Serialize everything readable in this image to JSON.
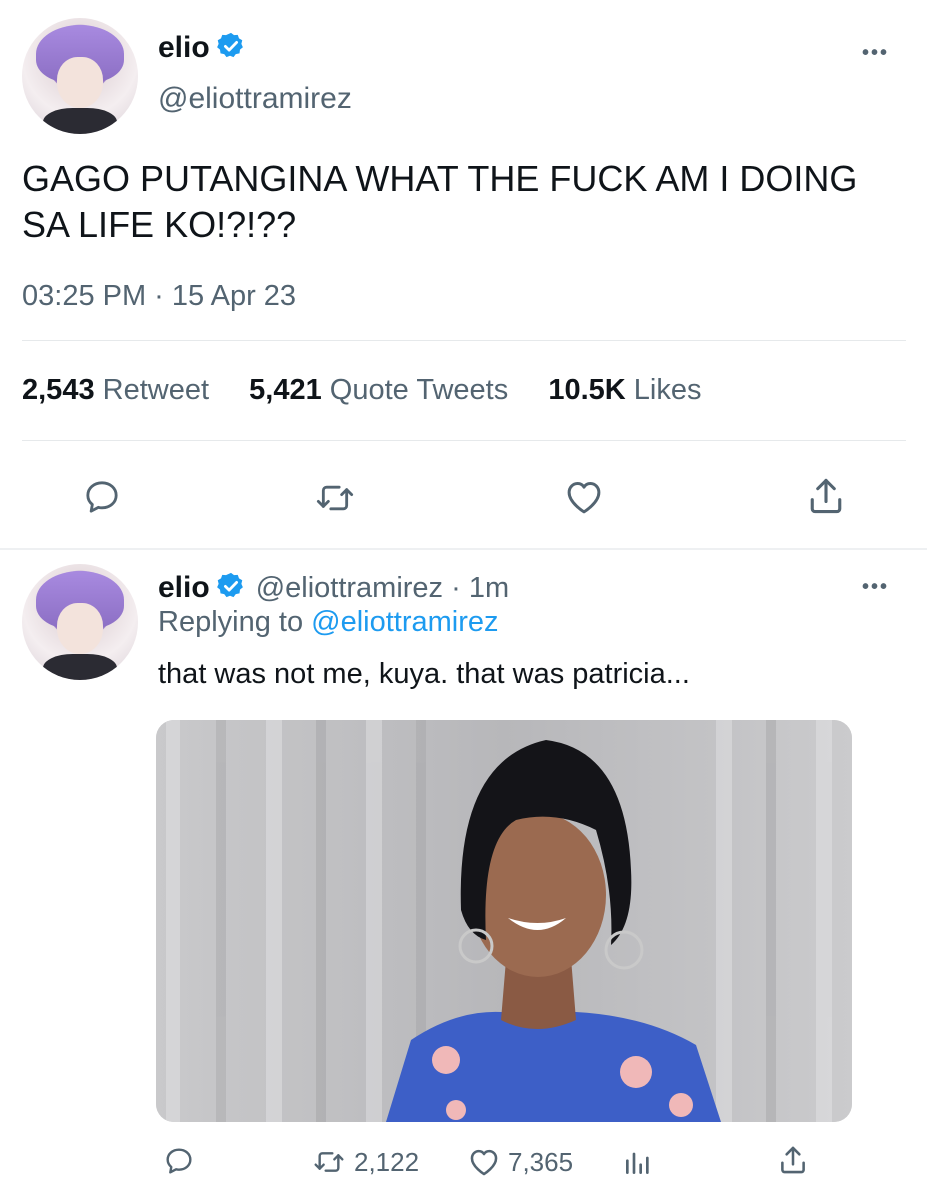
{
  "main_tweet": {
    "author_name": "elio",
    "handle": "@eliottramirez",
    "text": "GAGO PUTANGINA WHAT THE FUCK AM I DOING SA LIFE KO!?!??",
    "timestamp": "03:25 PM · 15 Apr 23",
    "stats": {
      "retweets_value": "2,543",
      "retweets_label": "Retweet",
      "quotes_value": "5,421",
      "quotes_label": "Quote Tweets",
      "likes_value": "10.5K",
      "likes_label": "Likes"
    },
    "more_label": "•••"
  },
  "reply_tweet": {
    "author_name": "elio",
    "handle_time": "@eliottramirez · 1m",
    "replying_prefix": "Replying to",
    "replying_handle": "@eliottramirez",
    "text": "that was not me, kuya. that was patricia...",
    "retweet_count": "2,122",
    "like_count": "7,365",
    "more_label": "•••"
  },
  "colors": {
    "accent": "#1d9bf0",
    "muted": "#536471",
    "text": "#0f1419",
    "divider": "#e6e9eb"
  },
  "icons": {
    "verified": "verified-badge-icon",
    "reply": "reply-icon",
    "retweet": "retweet-icon",
    "like": "heart-icon",
    "share": "share-icon",
    "analytics": "analytics-icon"
  }
}
